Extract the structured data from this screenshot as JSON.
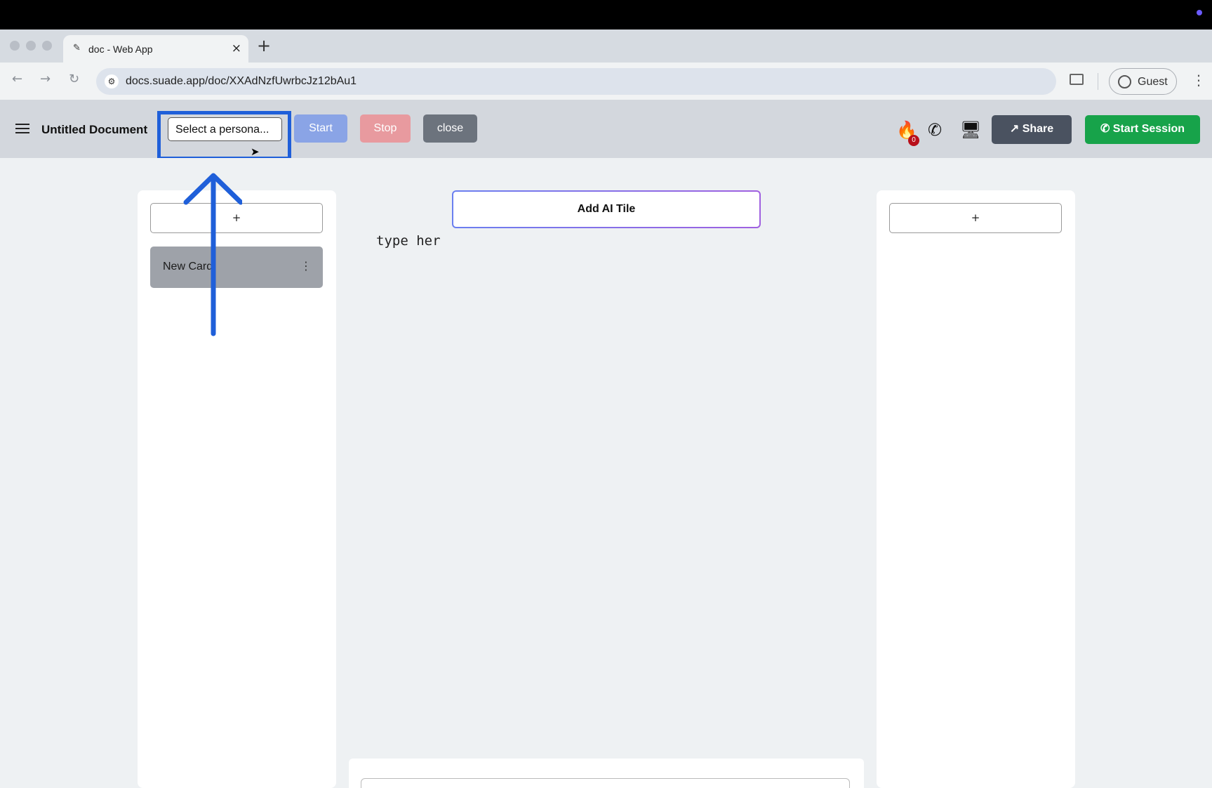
{
  "browser": {
    "tab_title": "doc - Web App",
    "tab_favicon": "pencil-icon",
    "new_tab_label": "+",
    "url": "docs.suade.app/doc/XXAdNzfUwrbcJz12bAu1",
    "profile_label": "Guest"
  },
  "header": {
    "doc_title": "Untitled Document",
    "persona_placeholder": "Select a persona...",
    "start_label": "Start",
    "stop_label": "Stop",
    "close_label": "close",
    "fire_count": "0",
    "share_label": "Share",
    "start_session_label": "Start Session"
  },
  "left_column": {
    "add_label": "+",
    "cards": [
      {
        "title": "New Card"
      }
    ]
  },
  "center": {
    "ai_tile_label": "Add AI Tile",
    "editor_text": "type her"
  },
  "right_column": {
    "add_label": "+"
  },
  "colors": {
    "start_session": "#17a34a",
    "share": "#4a5260",
    "annotation": "#1f5fd9"
  }
}
